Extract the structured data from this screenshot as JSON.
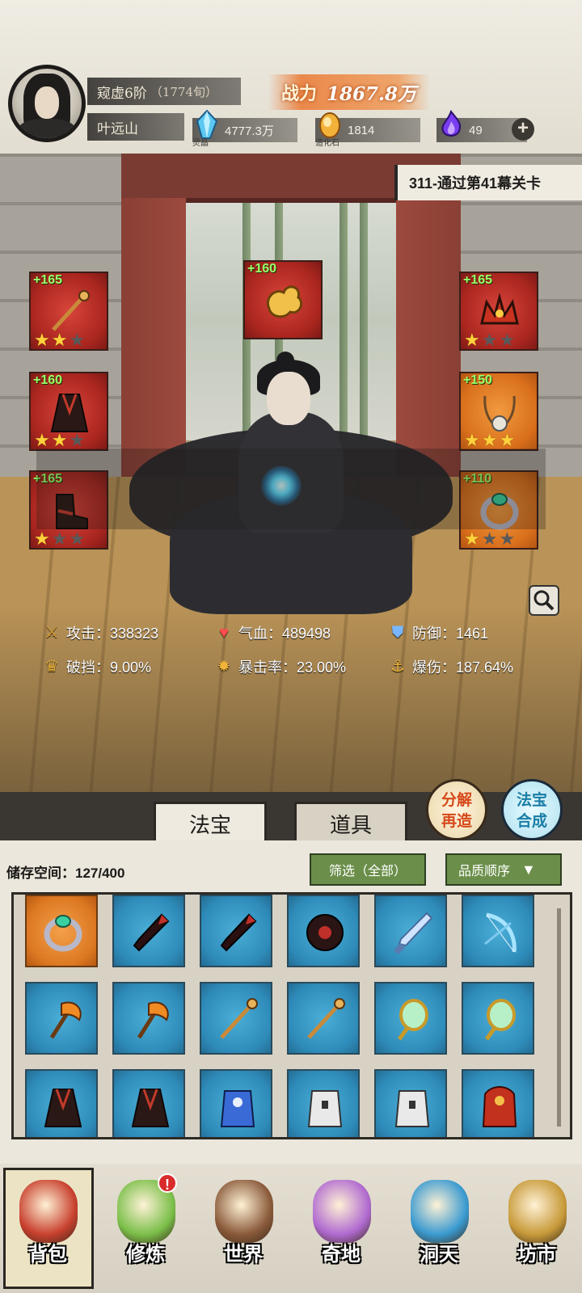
{
  "player": {
    "realm": "窥虚6阶",
    "age": "（1774旬）",
    "name": "叶远山",
    "avatar_icon": "player-portrait"
  },
  "power": {
    "label": "战力",
    "value": "1867.8万"
  },
  "resources": [
    {
      "id": "crystal",
      "icon": "blue-crystal-icon",
      "caption": "灵晶",
      "value": "4777.3万"
    },
    {
      "id": "stone",
      "icon": "golden-stone-icon",
      "caption": "造化石",
      "value": "1814"
    },
    {
      "id": "fire",
      "icon": "purple-flame-icon",
      "caption": "",
      "value": "49"
    }
  ],
  "stage": {
    "text": "311-通过第41幕关卡"
  },
  "equipment": [
    {
      "slot": "weapon",
      "level": "+165",
      "stars": 2,
      "max_stars": 3,
      "quality": "red",
      "icon": "staff-icon"
    },
    {
      "slot": "amulet",
      "level": "+160",
      "stars": 0,
      "max_stars": 0,
      "quality": "red",
      "icon": "golden-cloud-icon"
    },
    {
      "slot": "crown",
      "level": "+165",
      "stars": 1,
      "max_stars": 3,
      "quality": "red",
      "icon": "crown-icon"
    },
    {
      "slot": "robe",
      "level": "+160",
      "stars": 2,
      "max_stars": 3,
      "quality": "red",
      "icon": "robe-icon"
    },
    {
      "slot": "necklace",
      "level": "+150",
      "stars": 3,
      "max_stars": 3,
      "quality": "orange",
      "icon": "necklace-icon"
    },
    {
      "slot": "boots",
      "level": "+165",
      "stars": 1,
      "max_stars": 3,
      "quality": "red",
      "icon": "boots-icon"
    },
    {
      "slot": "ring",
      "level": "+110",
      "stars": 1,
      "max_stars": 3,
      "quality": "orange",
      "icon": "ring-icon"
    }
  ],
  "stats": {
    "attack": {
      "label": "攻击：338323",
      "icon": "sword-icon"
    },
    "hp": {
      "label": "气血：489498",
      "icon": "heart-icon"
    },
    "defense": {
      "label": "防御：1461",
      "icon": "shield-icon"
    },
    "break": {
      "label": "破挡：9.00%",
      "icon": "crown-break-icon"
    },
    "crit_rate": {
      "label": "暴击率：23.00%",
      "icon": "burst-icon"
    },
    "crit_dmg": {
      "label": "爆伤：187.64%",
      "icon": "anchor-burst-icon"
    }
  },
  "action_buttons": {
    "decompose": {
      "line1": "分解",
      "line2": "再造"
    },
    "synthesize": {
      "line1": "法宝",
      "line2": "合成"
    }
  },
  "tabs": [
    {
      "label": "法宝",
      "active": true
    },
    {
      "label": "道具",
      "active": false
    }
  ],
  "inventory": {
    "storage": "储存空间：127/400",
    "filter": "筛选（全部）",
    "sort": "品质顺序",
    "items": [
      {
        "icon": "ring-icon",
        "quality": "orange"
      },
      {
        "icon": "dark-blade-icon",
        "quality": "blue"
      },
      {
        "icon": "dark-blade-icon",
        "quality": "blue"
      },
      {
        "icon": "saw-disc-icon",
        "quality": "blue"
      },
      {
        "icon": "ice-sword-icon",
        "quality": "blue"
      },
      {
        "icon": "bow-icon",
        "quality": "blue"
      },
      {
        "icon": "fire-axe-icon",
        "quality": "blue"
      },
      {
        "icon": "fire-axe-icon",
        "quality": "blue"
      },
      {
        "icon": "staff-icon",
        "quality": "blue"
      },
      {
        "icon": "staff-icon",
        "quality": "blue"
      },
      {
        "icon": "jade-mirror-icon",
        "quality": "blue"
      },
      {
        "icon": "jade-mirror-icon",
        "quality": "blue"
      },
      {
        "icon": "robe-icon",
        "quality": "blue"
      },
      {
        "icon": "robe-icon",
        "quality": "blue"
      },
      {
        "icon": "blue-armor-icon",
        "quality": "blue"
      },
      {
        "icon": "white-armor-icon",
        "quality": "blue"
      },
      {
        "icon": "white-armor-icon",
        "quality": "blue"
      },
      {
        "icon": "red-armor-icon",
        "quality": "blue"
      }
    ]
  },
  "nav": [
    {
      "label": "背包",
      "icon": "bag-icon",
      "active": true,
      "badge": ""
    },
    {
      "label": "修炼",
      "icon": "lotus-icon",
      "active": false,
      "badge": "!"
    },
    {
      "label": "世界",
      "icon": "scroll-map-icon",
      "active": false,
      "badge": ""
    },
    {
      "label": "奇地",
      "icon": "mountain-pagoda-icon",
      "active": false,
      "badge": ""
    },
    {
      "label": "洞天",
      "icon": "portal-gate-icon",
      "active": false,
      "badge": ""
    },
    {
      "label": "坊市",
      "icon": "market-chest-icon",
      "active": false,
      "badge": ""
    }
  ],
  "colors": {
    "level_green": "#9dff6b",
    "quality_red": "#a9261f",
    "quality_orange": "#d96f1c",
    "quality_blue": "#2f8cba",
    "star": "#ffd23c"
  }
}
